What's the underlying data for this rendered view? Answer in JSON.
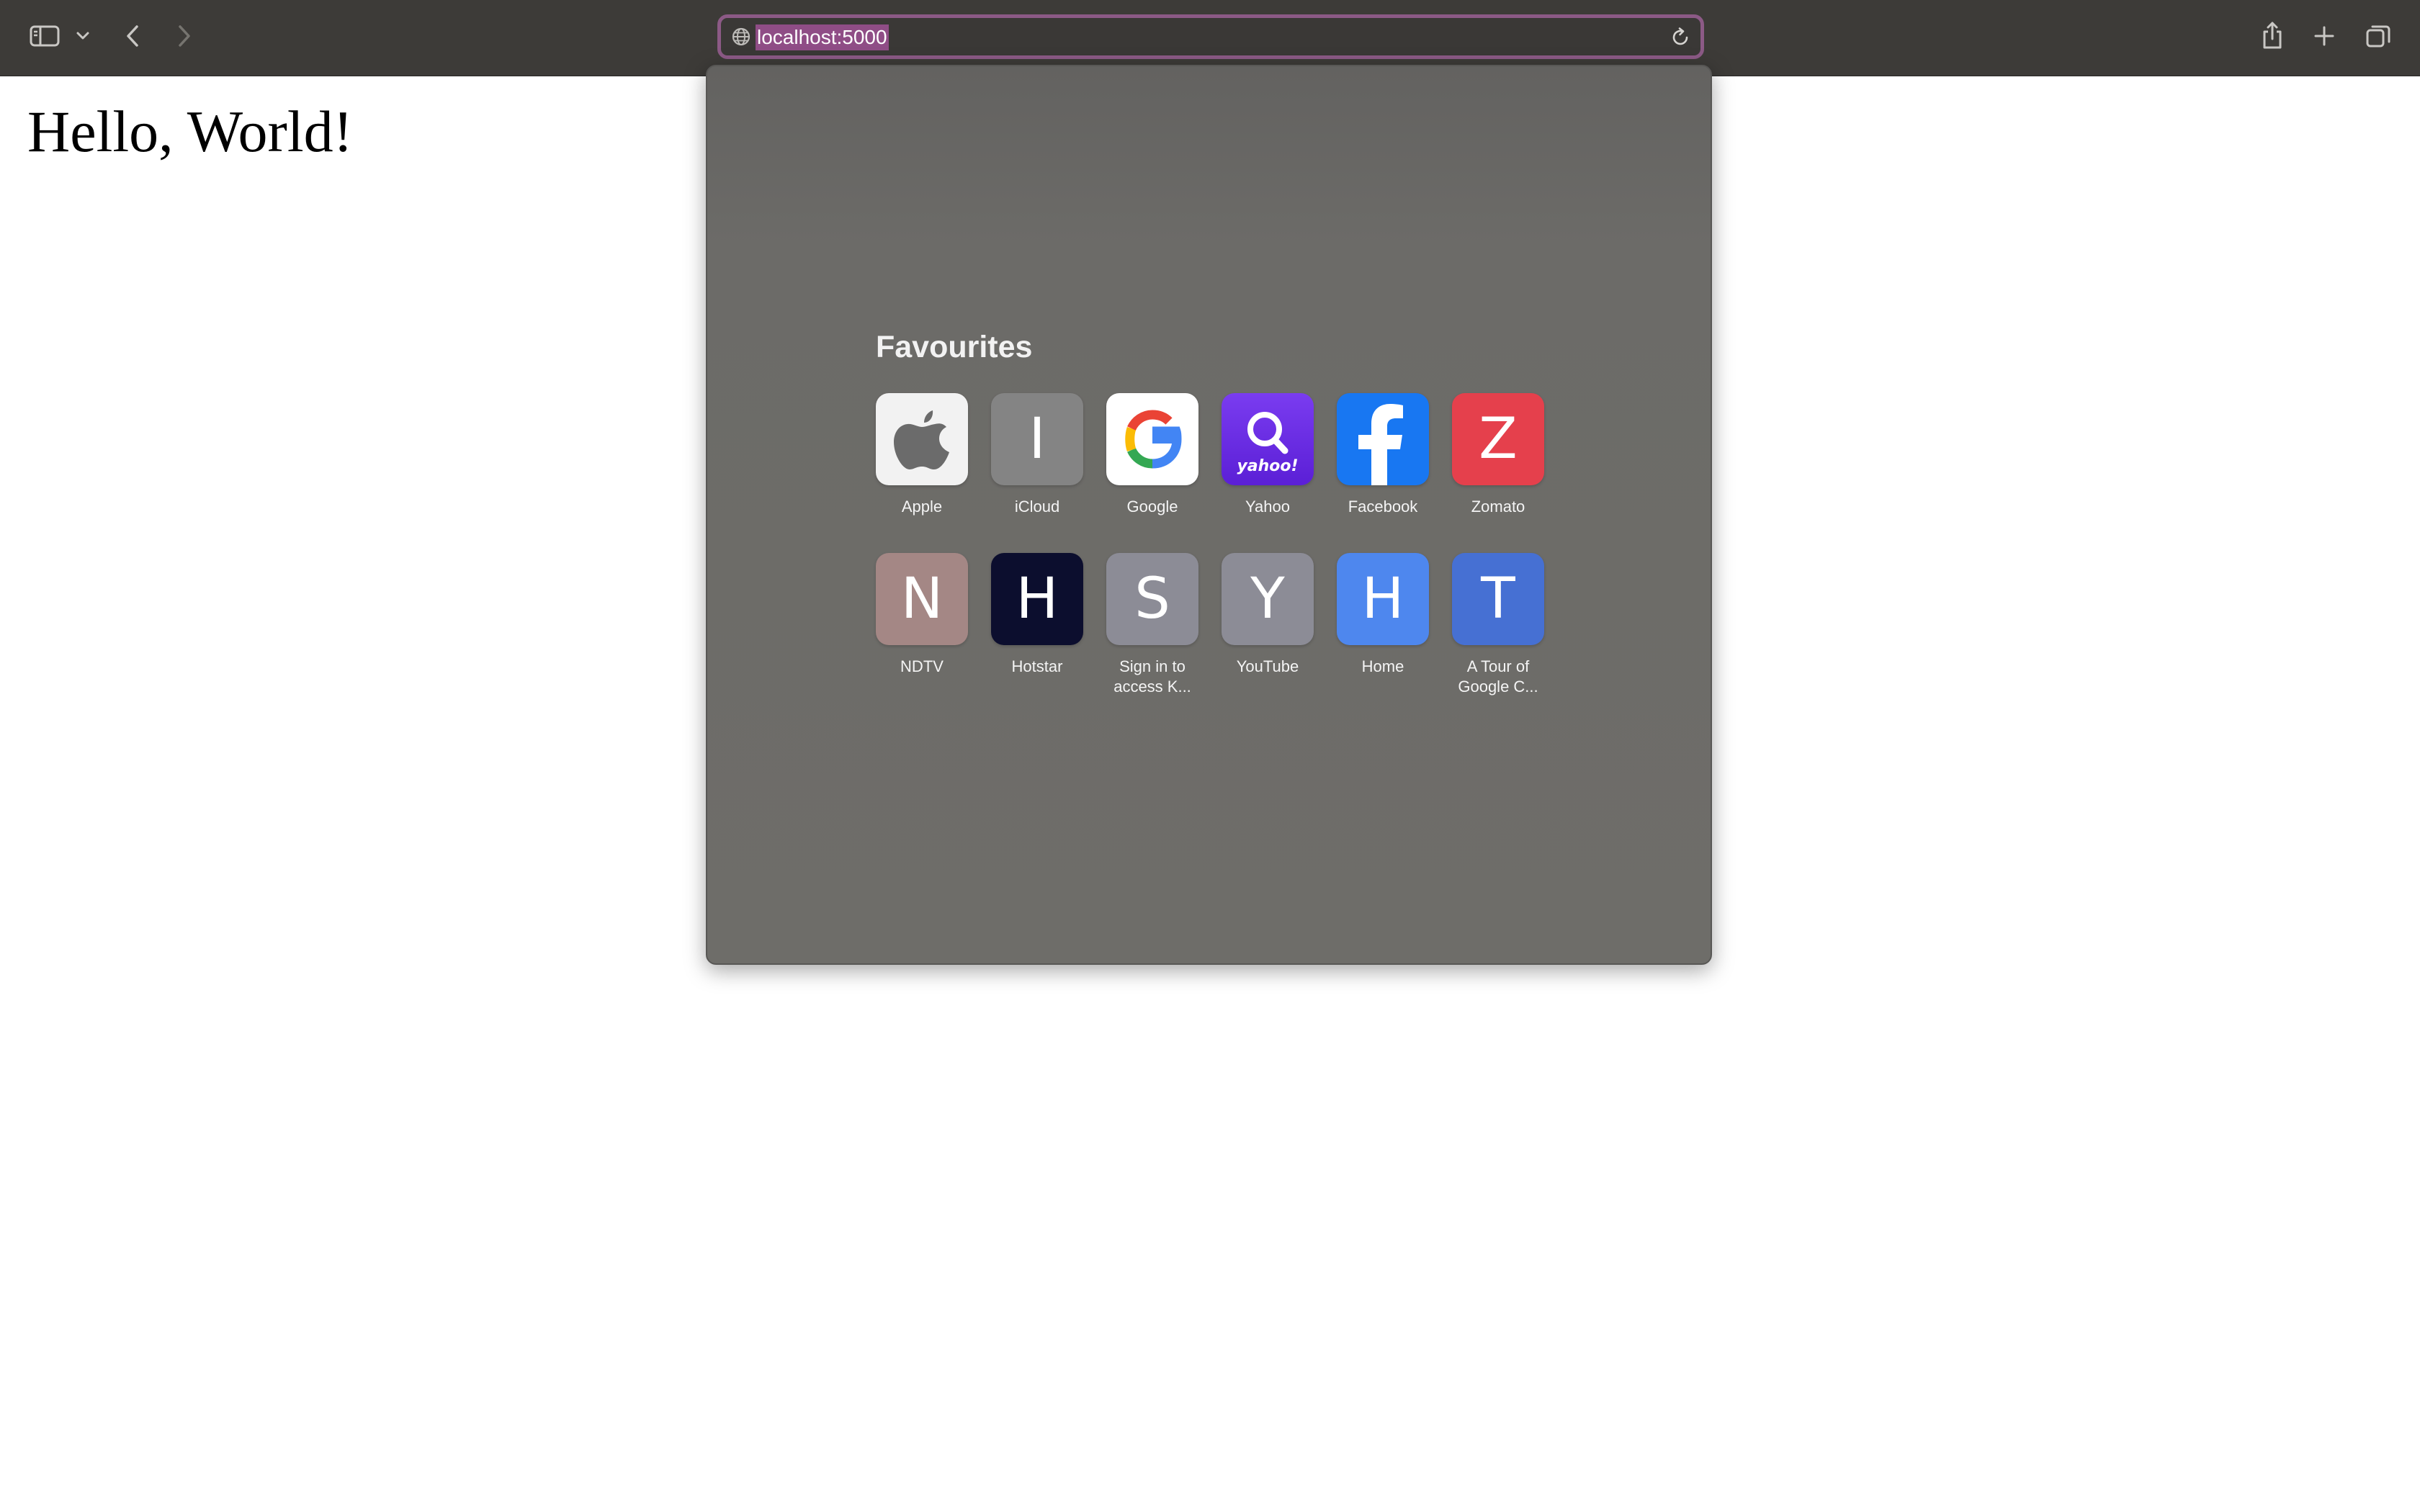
{
  "toolbar": {
    "url": "localhost:5000",
    "colors": {
      "background": "#3d3b38",
      "address_border": "#8c5a86",
      "selection": "#8f4d86"
    }
  },
  "page": {
    "heading": "Hello, World!"
  },
  "favourites": {
    "title": "Favourites",
    "items": [
      {
        "label": "Apple",
        "tile": "apple-logo",
        "bg": "#f2f2f2"
      },
      {
        "label": "iCloud",
        "letter": "I",
        "bg": "#848484"
      },
      {
        "label": "Google",
        "tile": "google-logo",
        "bg": "#ffffff"
      },
      {
        "label": "Yahoo",
        "tile": "yahoo-logo",
        "bg": "#6a2de0"
      },
      {
        "label": "Facebook",
        "tile": "facebook-logo",
        "bg": "#1877f2"
      },
      {
        "label": "Zomato",
        "letter": "Z",
        "bg": "#e5404c"
      },
      {
        "label": "NDTV",
        "letter": "N",
        "bg": "#a48785"
      },
      {
        "label": "Hotstar",
        "letter": "H",
        "bg": "#0c0e2e"
      },
      {
        "label": "Sign in to\naccess K...",
        "letter": "S",
        "bg": "#8c8c96"
      },
      {
        "label": "YouTube",
        "letter": "Y",
        "bg": "#8c8c96"
      },
      {
        "label": "Home",
        "letter": "H",
        "bg": "#4e87ee"
      },
      {
        "label": "A Tour of\nGoogle C...",
        "letter": "T",
        "bg": "#4670d3"
      }
    ]
  }
}
